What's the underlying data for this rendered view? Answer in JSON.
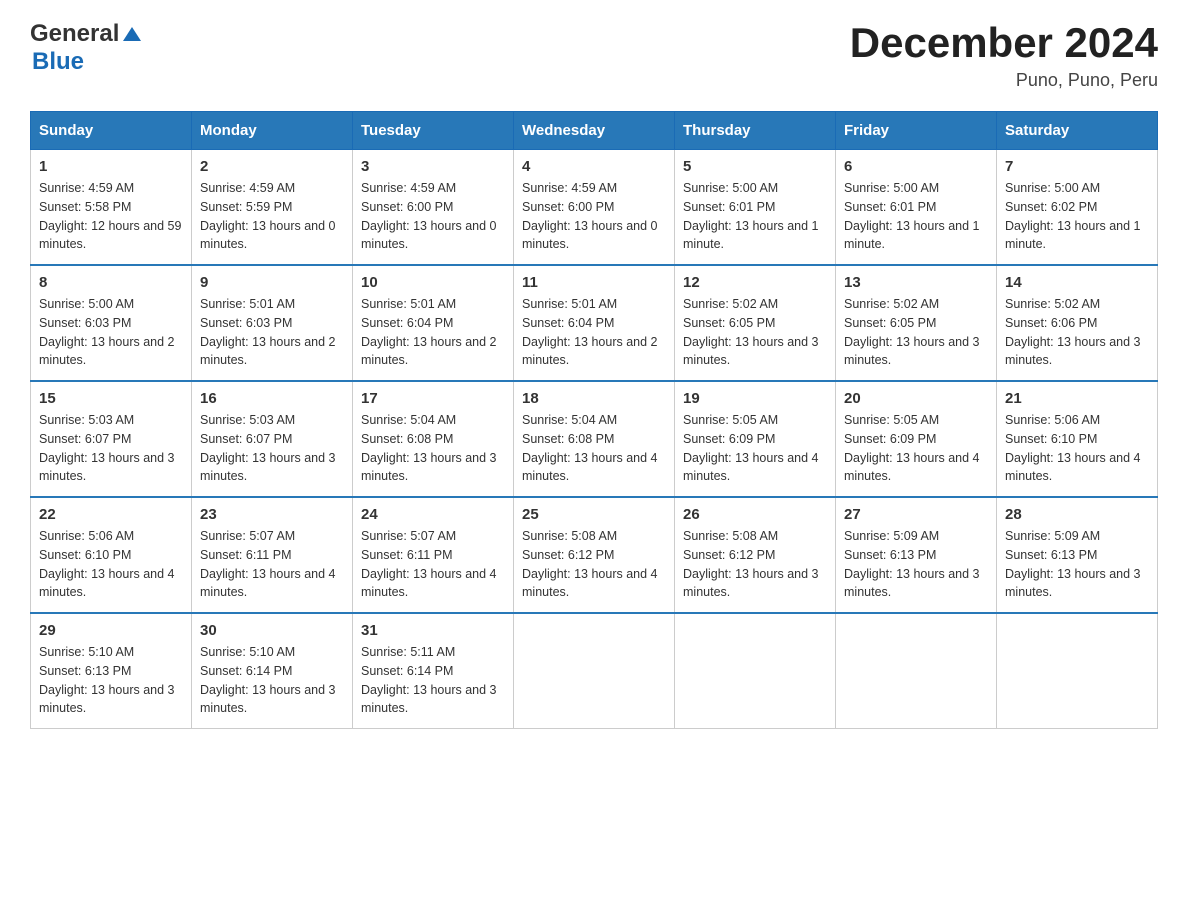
{
  "header": {
    "logo": {
      "general": "General",
      "blue": "Blue",
      "aria": "GeneralBlue logo"
    },
    "title": "December 2024",
    "subtitle": "Puno, Puno, Peru"
  },
  "calendar": {
    "days_of_week": [
      "Sunday",
      "Monday",
      "Tuesday",
      "Wednesday",
      "Thursday",
      "Friday",
      "Saturday"
    ],
    "weeks": [
      [
        {
          "date": "1",
          "sunrise": "Sunrise: 4:59 AM",
          "sunset": "Sunset: 5:58 PM",
          "daylight": "Daylight: 12 hours and 59 minutes."
        },
        {
          "date": "2",
          "sunrise": "Sunrise: 4:59 AM",
          "sunset": "Sunset: 5:59 PM",
          "daylight": "Daylight: 13 hours and 0 minutes."
        },
        {
          "date": "3",
          "sunrise": "Sunrise: 4:59 AM",
          "sunset": "Sunset: 6:00 PM",
          "daylight": "Daylight: 13 hours and 0 minutes."
        },
        {
          "date": "4",
          "sunrise": "Sunrise: 4:59 AM",
          "sunset": "Sunset: 6:00 PM",
          "daylight": "Daylight: 13 hours and 0 minutes."
        },
        {
          "date": "5",
          "sunrise": "Sunrise: 5:00 AM",
          "sunset": "Sunset: 6:01 PM",
          "daylight": "Daylight: 13 hours and 1 minute."
        },
        {
          "date": "6",
          "sunrise": "Sunrise: 5:00 AM",
          "sunset": "Sunset: 6:01 PM",
          "daylight": "Daylight: 13 hours and 1 minute."
        },
        {
          "date": "7",
          "sunrise": "Sunrise: 5:00 AM",
          "sunset": "Sunset: 6:02 PM",
          "daylight": "Daylight: 13 hours and 1 minute."
        }
      ],
      [
        {
          "date": "8",
          "sunrise": "Sunrise: 5:00 AM",
          "sunset": "Sunset: 6:03 PM",
          "daylight": "Daylight: 13 hours and 2 minutes."
        },
        {
          "date": "9",
          "sunrise": "Sunrise: 5:01 AM",
          "sunset": "Sunset: 6:03 PM",
          "daylight": "Daylight: 13 hours and 2 minutes."
        },
        {
          "date": "10",
          "sunrise": "Sunrise: 5:01 AM",
          "sunset": "Sunset: 6:04 PM",
          "daylight": "Daylight: 13 hours and 2 minutes."
        },
        {
          "date": "11",
          "sunrise": "Sunrise: 5:01 AM",
          "sunset": "Sunset: 6:04 PM",
          "daylight": "Daylight: 13 hours and 2 minutes."
        },
        {
          "date": "12",
          "sunrise": "Sunrise: 5:02 AM",
          "sunset": "Sunset: 6:05 PM",
          "daylight": "Daylight: 13 hours and 3 minutes."
        },
        {
          "date": "13",
          "sunrise": "Sunrise: 5:02 AM",
          "sunset": "Sunset: 6:05 PM",
          "daylight": "Daylight: 13 hours and 3 minutes."
        },
        {
          "date": "14",
          "sunrise": "Sunrise: 5:02 AM",
          "sunset": "Sunset: 6:06 PM",
          "daylight": "Daylight: 13 hours and 3 minutes."
        }
      ],
      [
        {
          "date": "15",
          "sunrise": "Sunrise: 5:03 AM",
          "sunset": "Sunset: 6:07 PM",
          "daylight": "Daylight: 13 hours and 3 minutes."
        },
        {
          "date": "16",
          "sunrise": "Sunrise: 5:03 AM",
          "sunset": "Sunset: 6:07 PM",
          "daylight": "Daylight: 13 hours and 3 minutes."
        },
        {
          "date": "17",
          "sunrise": "Sunrise: 5:04 AM",
          "sunset": "Sunset: 6:08 PM",
          "daylight": "Daylight: 13 hours and 3 minutes."
        },
        {
          "date": "18",
          "sunrise": "Sunrise: 5:04 AM",
          "sunset": "Sunset: 6:08 PM",
          "daylight": "Daylight: 13 hours and 4 minutes."
        },
        {
          "date": "19",
          "sunrise": "Sunrise: 5:05 AM",
          "sunset": "Sunset: 6:09 PM",
          "daylight": "Daylight: 13 hours and 4 minutes."
        },
        {
          "date": "20",
          "sunrise": "Sunrise: 5:05 AM",
          "sunset": "Sunset: 6:09 PM",
          "daylight": "Daylight: 13 hours and 4 minutes."
        },
        {
          "date": "21",
          "sunrise": "Sunrise: 5:06 AM",
          "sunset": "Sunset: 6:10 PM",
          "daylight": "Daylight: 13 hours and 4 minutes."
        }
      ],
      [
        {
          "date": "22",
          "sunrise": "Sunrise: 5:06 AM",
          "sunset": "Sunset: 6:10 PM",
          "daylight": "Daylight: 13 hours and 4 minutes."
        },
        {
          "date": "23",
          "sunrise": "Sunrise: 5:07 AM",
          "sunset": "Sunset: 6:11 PM",
          "daylight": "Daylight: 13 hours and 4 minutes."
        },
        {
          "date": "24",
          "sunrise": "Sunrise: 5:07 AM",
          "sunset": "Sunset: 6:11 PM",
          "daylight": "Daylight: 13 hours and 4 minutes."
        },
        {
          "date": "25",
          "sunrise": "Sunrise: 5:08 AM",
          "sunset": "Sunset: 6:12 PM",
          "daylight": "Daylight: 13 hours and 4 minutes."
        },
        {
          "date": "26",
          "sunrise": "Sunrise: 5:08 AM",
          "sunset": "Sunset: 6:12 PM",
          "daylight": "Daylight: 13 hours and 3 minutes."
        },
        {
          "date": "27",
          "sunrise": "Sunrise: 5:09 AM",
          "sunset": "Sunset: 6:13 PM",
          "daylight": "Daylight: 13 hours and 3 minutes."
        },
        {
          "date": "28",
          "sunrise": "Sunrise: 5:09 AM",
          "sunset": "Sunset: 6:13 PM",
          "daylight": "Daylight: 13 hours and 3 minutes."
        }
      ],
      [
        {
          "date": "29",
          "sunrise": "Sunrise: 5:10 AM",
          "sunset": "Sunset: 6:13 PM",
          "daylight": "Daylight: 13 hours and 3 minutes."
        },
        {
          "date": "30",
          "sunrise": "Sunrise: 5:10 AM",
          "sunset": "Sunset: 6:14 PM",
          "daylight": "Daylight: 13 hours and 3 minutes."
        },
        {
          "date": "31",
          "sunrise": "Sunrise: 5:11 AM",
          "sunset": "Sunset: 6:14 PM",
          "daylight": "Daylight: 13 hours and 3 minutes."
        },
        null,
        null,
        null,
        null
      ]
    ]
  }
}
